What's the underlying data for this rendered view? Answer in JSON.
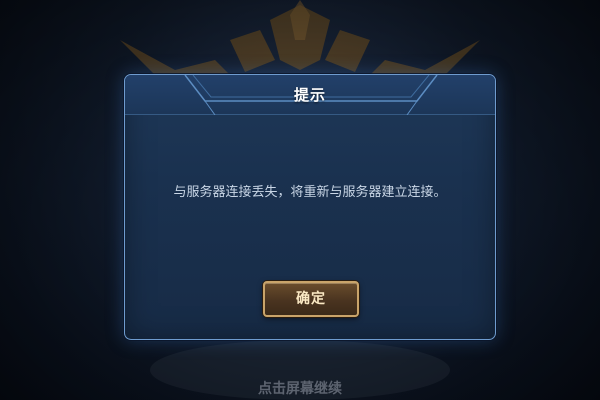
{
  "dialog": {
    "title": "提示",
    "message": "与服务器连接丢失，将重新与服务器建立连接。",
    "confirm_label": "确定"
  },
  "background": {
    "hint": "点击屏幕继续"
  },
  "colors": {
    "dialog_border": "#6f9ccf",
    "dialog_bg": "#1a314f",
    "button_border": "#c9a46a",
    "button_text": "#fbe9c4",
    "message_text": "#c9d6e6"
  }
}
